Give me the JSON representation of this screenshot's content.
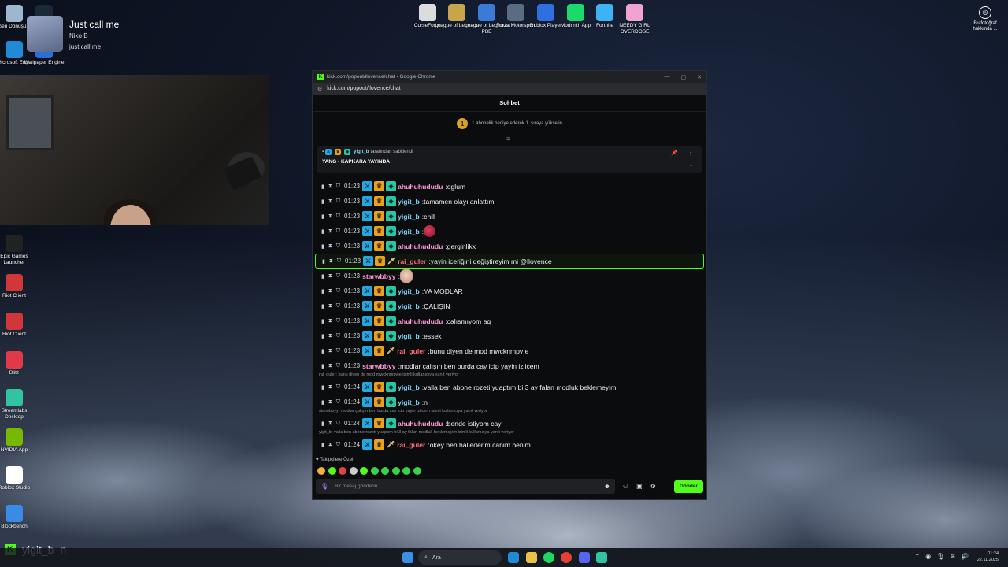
{
  "desktop": {
    "top_icons": [
      {
        "label": "CurseForge",
        "color": "#dcdcdc"
      },
      {
        "label": "League of Legends",
        "color": "#c8a44a"
      },
      {
        "label": "League of Legends PBE",
        "color": "#3a7bd5"
      },
      {
        "label": "Forza Motorsport",
        "color": "#5a6c83"
      },
      {
        "label": "Roblox Player",
        "color": "#2f6fe0"
      },
      {
        "label": "Modrinth App",
        "color": "#1bd96a"
      },
      {
        "label": "Fortnite",
        "color": "#3db3f3"
      },
      {
        "label": "NEEDY GIRL OVERDOSE",
        "color": "#f2a2d0"
      }
    ],
    "left_icons": [
      {
        "label": "Geri Dönüşü...",
        "color": "#9fb6cf"
      },
      {
        "label": "Microsoft Edge",
        "color": "#1f8ad6"
      },
      {
        "label": "Epic Games Launcher",
        "color": "#222222"
      },
      {
        "label": "Riot Client",
        "color": "#d13639"
      },
      {
        "label": "Riot Client",
        "color": "#d13639"
      },
      {
        "label": "Blitz",
        "color": "#e03a4a"
      },
      {
        "label": "Streamlabs Desktop",
        "color": "#31c3a2"
      },
      {
        "label": "NVIDIA App",
        "color": "#76b900"
      },
      {
        "label": "Roblox Studio",
        "color": "#ffffff"
      },
      {
        "label": "Blockbench",
        "color": "#3c8ae8"
      }
    ],
    "overlay_icons": [
      {
        "label": "Steam"
      },
      {
        "label": "Wallpaper Engine"
      }
    ],
    "photo_info": "Bu fotoğraf hakkında ..."
  },
  "now_playing": {
    "title": "Just call me",
    "artist": "Niko B",
    "album": "just call me"
  },
  "browser": {
    "title": "kick.com/popout/llovence/chat - Google Chrome",
    "url": "kick.com/popout/llovence/chat"
  },
  "chat": {
    "header": "Sohbet",
    "gift_rank": "1",
    "gift_text": "1 abonelik hediye ederek 1. sıraya yükselin",
    "pinned_by_user": "yigit_b",
    "pinned_by_suffix": "tarafından sabitlendi",
    "pinned_title": "YANG - KAPKARA YAYINDA",
    "messages": [
      {
        "time": "01:23",
        "badges": [
          "mod",
          "crown",
          "vip"
        ],
        "user": "ahuhuhududu",
        "color": "pink",
        "text": "oglum"
      },
      {
        "time": "01:23",
        "badges": [
          "mod",
          "crown",
          "vip"
        ],
        "user": "yigit_b",
        "color": "cyan",
        "text": "tamamen olayı anlattım"
      },
      {
        "time": "01:23",
        "badges": [
          "mod",
          "crown",
          "vip"
        ],
        "user": "yigit_b",
        "color": "cyan",
        "text": "chill"
      },
      {
        "time": "01:23",
        "badges": [
          "mod",
          "crown",
          "vip"
        ],
        "user": "yigit_b",
        "color": "cyan",
        "text": "",
        "emote": "red"
      },
      {
        "time": "01:23",
        "badges": [
          "mod",
          "crown",
          "vip"
        ],
        "user": "ahuhuhududu",
        "color": "pink",
        "text": "gerginlikk"
      },
      {
        "time": "01:23",
        "badges": [
          "mod",
          "crown",
          "sword"
        ],
        "user": "rai_guler",
        "color": "red",
        "text": "yayin iceriğini değiştireyim mi @llovence",
        "highlight": true
      },
      {
        "time": "01:23",
        "badges": [],
        "user": "starwbbyy",
        "color": "pink",
        "text": "",
        "emote": "anime"
      },
      {
        "time": "01:23",
        "badges": [
          "mod",
          "crown",
          "vip"
        ],
        "user": "yigit_b",
        "color": "cyan",
        "text": "YA MODLAR"
      },
      {
        "time": "01:23",
        "badges": [
          "mod",
          "crown",
          "vip"
        ],
        "user": "yigit_b",
        "color": "cyan",
        "text": "ÇALIŞIN"
      },
      {
        "time": "01:23",
        "badges": [
          "mod",
          "crown",
          "vip"
        ],
        "user": "ahuhuhududu",
        "color": "pink",
        "text": "calısmıyom aq"
      },
      {
        "time": "01:23",
        "badges": [
          "mod",
          "crown",
          "vip"
        ],
        "user": "yigit_b",
        "color": "cyan",
        "text": "essek"
      },
      {
        "time": "01:23",
        "badges": [
          "mod",
          "crown",
          "sword"
        ],
        "user": "rai_guler",
        "color": "red",
        "text": "bunu diyen de mod mwcknmpvıe"
      },
      {
        "time": "01:23",
        "badges": [],
        "user": "starwbbyy",
        "color": "pink",
        "text": "modlar çalışın ben burda cay icip yayin izlicem"
      },
      {
        "reply": "rai_guler: bunu diyen de mod mwcknmpvıe isimli kullanıcıya yanıt veriyor",
        "time": "01:24",
        "badges": [
          "mod",
          "crown",
          "vip"
        ],
        "user": "yigit_b",
        "color": "cyan",
        "text": "valla ben abone rozeti yuaptım bi 3 ay falan modluk beklemeyim"
      },
      {
        "time": "01:24",
        "badges": [
          "mod",
          "crown",
          "vip"
        ],
        "user": "yigit_b",
        "color": "cyan",
        "text": "n"
      },
      {
        "reply": "starwbbyy: modlar çalışın ben burda cay icip yayin izlicem isimli kullanıcıya yanıt veriyor",
        "time": "01:24",
        "badges": [
          "mod",
          "crown",
          "vip"
        ],
        "user": "ahuhuhududu",
        "color": "pink",
        "text": "bende istiyom cay"
      },
      {
        "reply": "yigit_b: valla ben abone rozeti yuaptım bi 3 ay falan modluk beklemeyim isimli kullanıcıya yanıt veriyor",
        "time": "01:24",
        "badges": [
          "mod",
          "crown",
          "sword"
        ],
        "user": "rai_guler",
        "color": "red",
        "text": "okey ben hallederim canim benim"
      }
    ],
    "follower_note": "Takipçilere Özel",
    "input_placeholder": "Bir mesaj gönderin",
    "send_label": "Gönder"
  },
  "caption": {
    "user": "yigit_b",
    "message": "n"
  },
  "taskbar": {
    "search_label": "Ara",
    "clock_time": "01:24",
    "clock_date": "22.11.2025"
  }
}
